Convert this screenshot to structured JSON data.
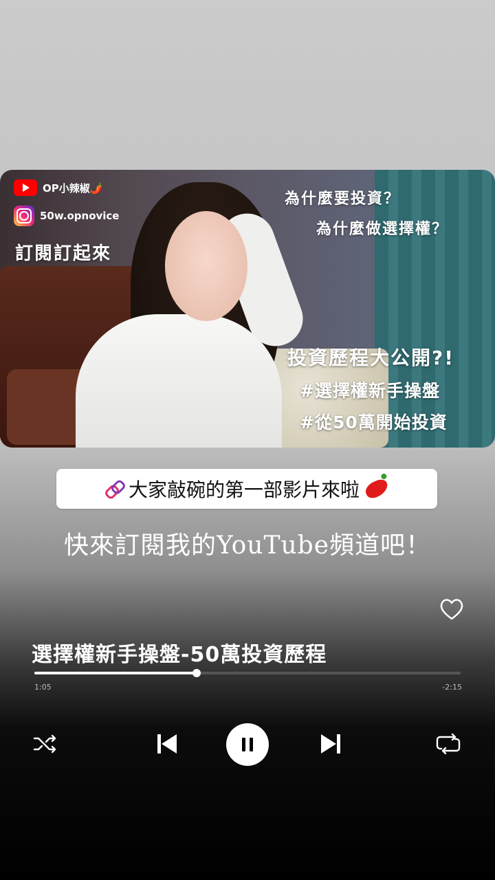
{
  "thumbnail": {
    "youtube_handle": "OP小辣椒🌶️",
    "instagram_handle": "50w.opnovice",
    "subscribe_cta": "訂閱訂起來",
    "question1": "為什麼要投資？",
    "question2": "為什麼做選擇權？",
    "headline": "投資歷程大公開?!",
    "tag1": "#選擇權新手操盤",
    "tag2": "#從50萬開始投資"
  },
  "link_sticker": {
    "text": "大家敲碗的第一部影片來啦"
  },
  "caption": "快來訂閱我的YouTube頻道吧！",
  "player": {
    "song_title": "選擇權新手操盤-50萬投資歷程",
    "elapsed": "1:05",
    "remaining": "-2:15",
    "progress": 0.38
  },
  "icons": [
    "youtube-icon",
    "instagram-icon",
    "link-icon",
    "chili-pepper-icon",
    "heart-icon",
    "shuffle-icon",
    "previous-icon",
    "pause-icon",
    "next-icon",
    "repeat-icon"
  ],
  "colors": {
    "accent": "#ffffff",
    "youtube_red": "#ff0000"
  }
}
